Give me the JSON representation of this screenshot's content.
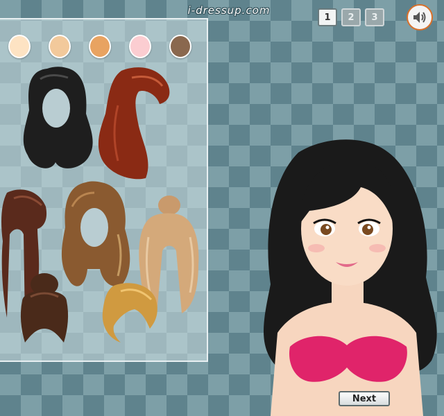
{
  "header": {
    "site_title": "i-dressup.com"
  },
  "pager": {
    "pages": [
      "1",
      "2",
      "3"
    ],
    "active_page": "1"
  },
  "skin_tones": [
    "#fde3c3",
    "#f2c99b",
    "#e8a361",
    "#fbcdd1",
    "#8a684e"
  ],
  "hair_options": [
    {
      "name": "long-wavy-black",
      "color": "#1e1e1e"
    },
    {
      "name": "side-swept-auburn",
      "color": "#8a2a14"
    },
    {
      "name": "pigtails-mahogany",
      "color": "#5a2a1c"
    },
    {
      "name": "long-wavy-brown",
      "color": "#8a5a30"
    },
    {
      "name": "high-ponytail-blonde",
      "color": "#d4a97a"
    },
    {
      "name": "bun-dark-brown",
      "color": "#4a2a1a"
    },
    {
      "name": "short-bob-gold",
      "color": "#d09a40"
    }
  ],
  "model": {
    "hair_color": "#1a1a1a",
    "top_color": "#e0246a"
  },
  "buttons": {
    "next_label": "Next"
  }
}
